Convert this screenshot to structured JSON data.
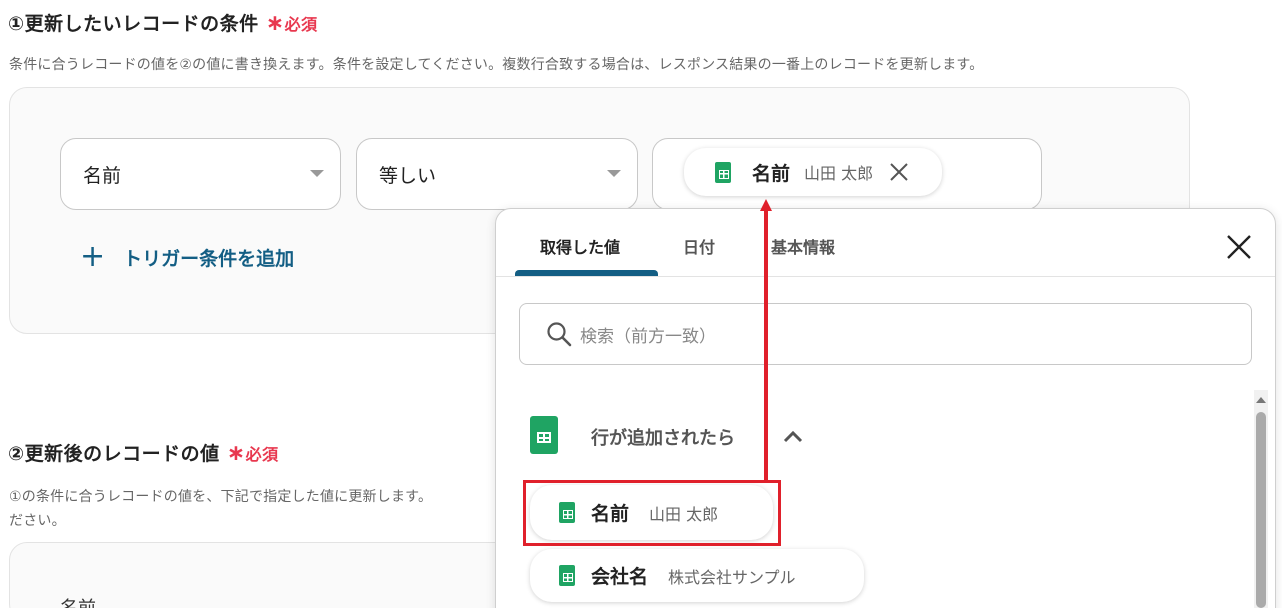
{
  "section1": {
    "title": "①更新したいレコードの条件",
    "required_star": "∗",
    "required_label": "必須",
    "description": "条件に合うレコードの値を②の値に書き換えます。条件を設定してください。複数行合致する場合は、レスポンス結果の一番上のレコードを更新します。",
    "field_select": "名前",
    "operator_select": "等しい",
    "value_chip": {
      "label": "名前",
      "value": "山田 太郎"
    },
    "add_condition": "トリガー条件を追加"
  },
  "section2": {
    "title": "②更新後のレコードの値",
    "required_star": "∗",
    "required_label": "必須",
    "description_line1": "①の条件に合うレコードの値を、下記で指定した値に更新します。",
    "description_line2": "ださい。",
    "first_field_label": "名前"
  },
  "dropdown": {
    "tabs": [
      {
        "label": "取得した値",
        "active": true
      },
      {
        "label": "日付",
        "active": false
      },
      {
        "label": "基本情報",
        "active": false
      }
    ],
    "search_placeholder": "検索（前方一致）",
    "group": {
      "label": "行が追加されたら",
      "expanded": true
    },
    "items": [
      {
        "label": "名前",
        "value": "山田 太郎",
        "highlighted": true
      },
      {
        "label": "会社名",
        "value": "株式会社サンプル",
        "highlighted": false
      }
    ]
  },
  "colors": {
    "accent": "#135e84",
    "required": "#e8384f",
    "highlight": "#e0202b",
    "sheets_green": "#1fa463"
  },
  "icons": {
    "sheet": "google-sheets-icon",
    "close": "close-icon",
    "search": "search-icon",
    "chevron": "chevron-up-icon",
    "plus": "plus-icon",
    "caret": "caret-down-icon"
  }
}
